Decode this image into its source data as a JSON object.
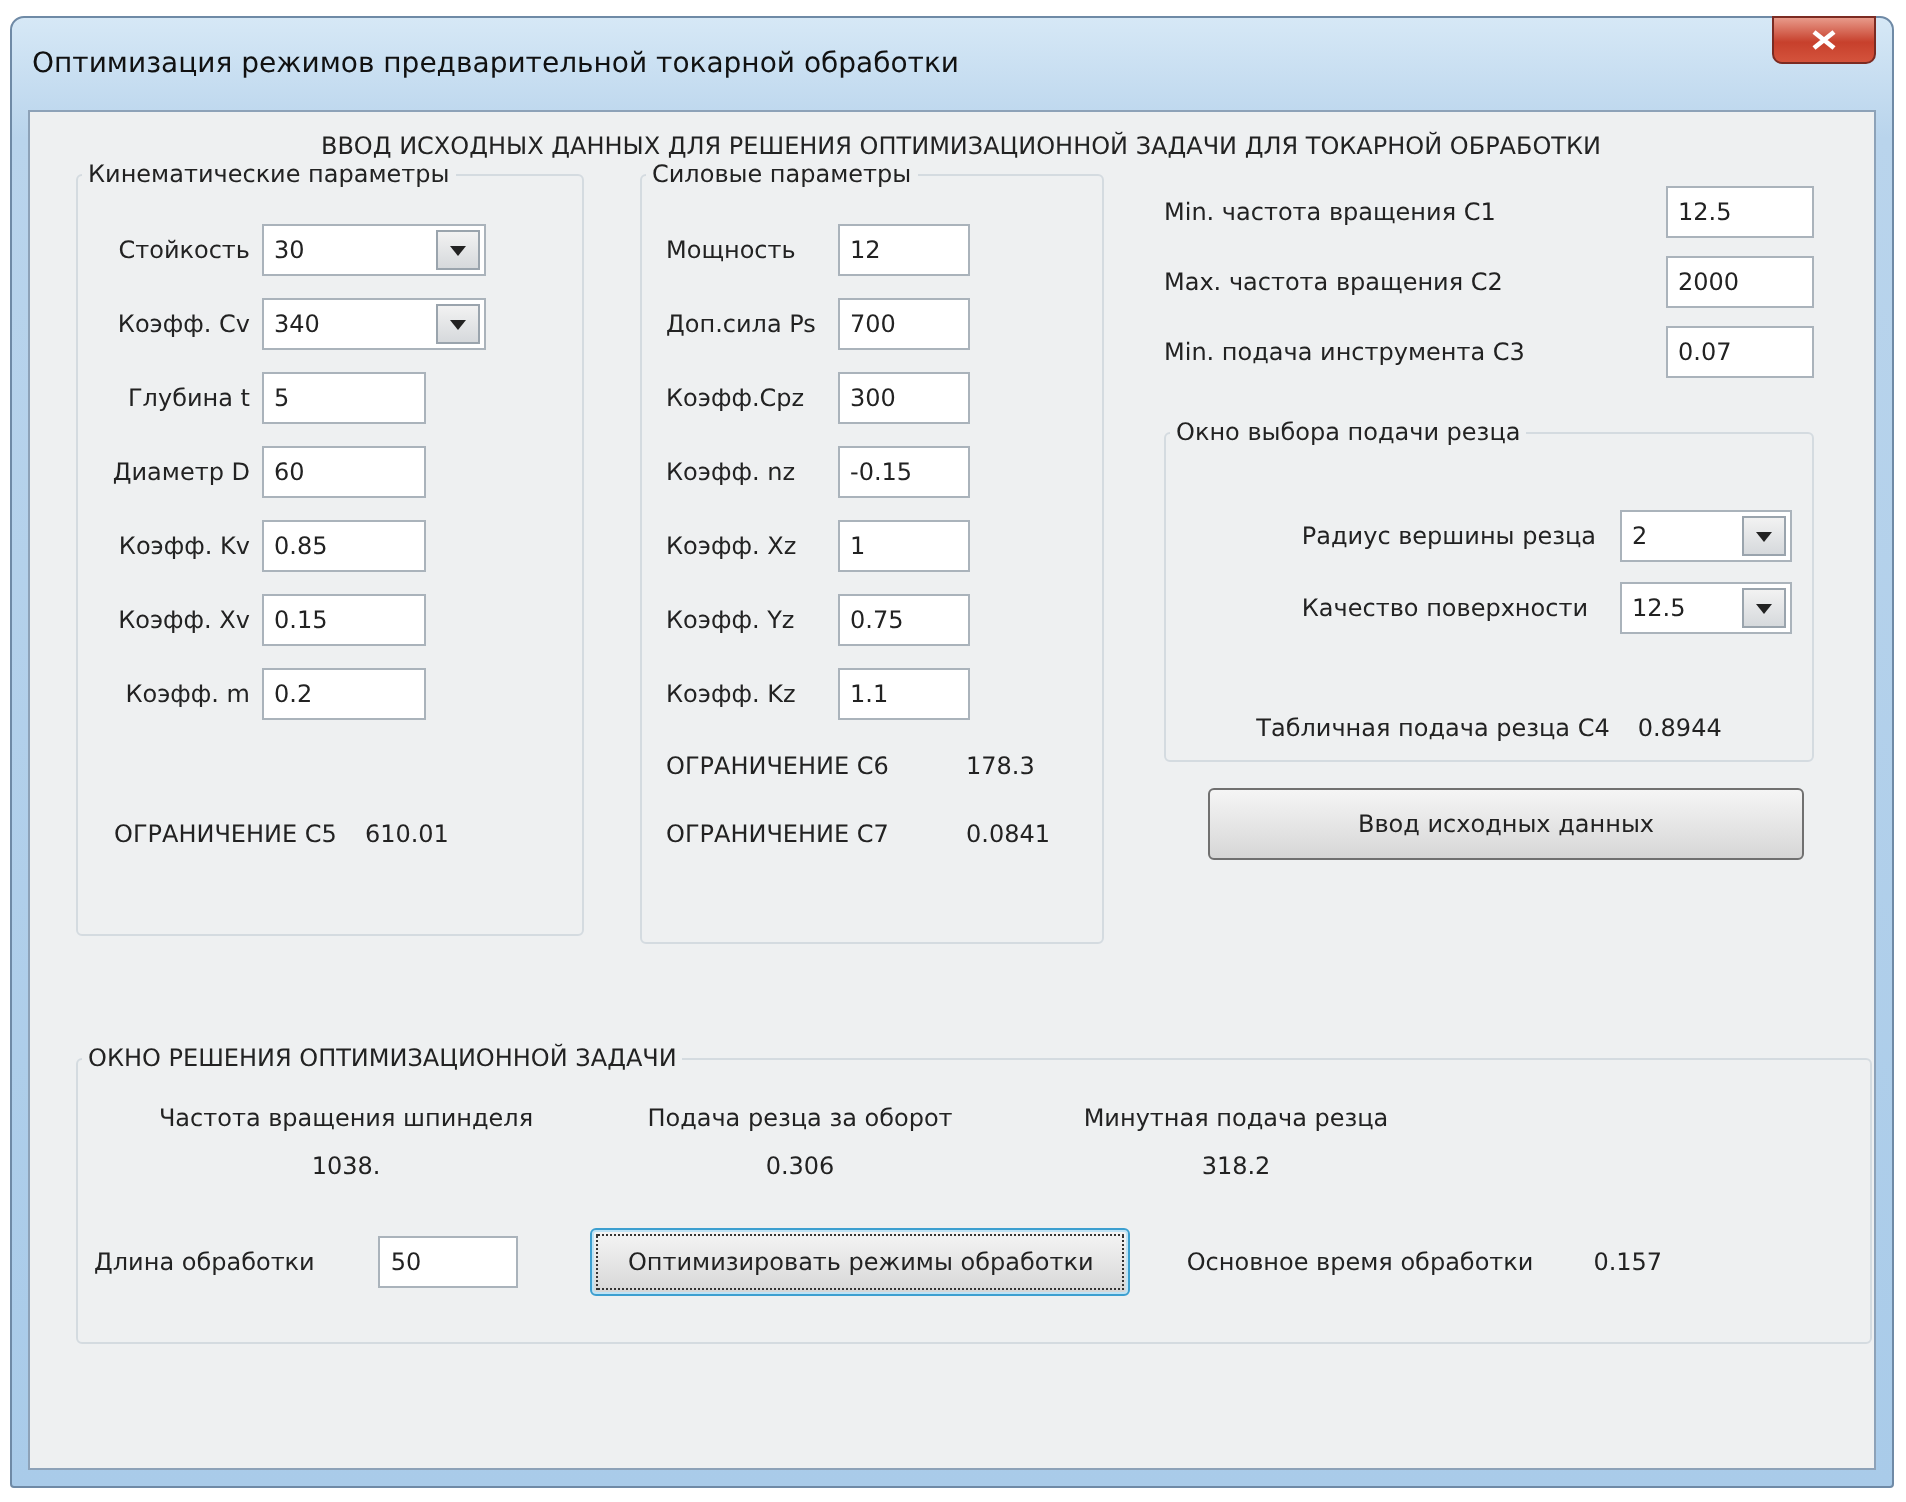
{
  "window": {
    "title": "Оптимизация режимов предварительной токарной обработки"
  },
  "heading": "ВВОД ИСХОДНЫХ ДАННЫХ ДЛЯ РЕШЕНИЯ ОПТИМИЗАЦИОННОЙ ЗАДАЧИ ДЛЯ ТОКАРНОЙ ОБРАБОТКИ",
  "kinematic": {
    "title": "Кинематические параметры",
    "fields": [
      {
        "label": "Стойкость",
        "value": "30",
        "kind": "combo"
      },
      {
        "label": "Коэфф. Cv",
        "value": "340",
        "kind": "combo"
      },
      {
        "label": "Глубина t",
        "value": "5",
        "kind": "text"
      },
      {
        "label": "Диаметр D",
        "value": "60",
        "kind": "text"
      },
      {
        "label": "Коэфф. Kv",
        "value": "0.85",
        "kind": "text"
      },
      {
        "label": "Коэфф. Xv",
        "value": "0.15",
        "kind": "text"
      },
      {
        "label": "Коэфф. m",
        "value": "0.2",
        "kind": "text"
      }
    ],
    "limits": [
      {
        "label": "ОГРАНИЧЕНИЕ  C5",
        "value": "610.01"
      }
    ]
  },
  "force": {
    "title": "Силовые параметры",
    "fields": [
      {
        "label": "Мощность",
        "value": "12",
        "kind": "text"
      },
      {
        "label": "Доп.сила Ps",
        "value": "700",
        "kind": "text"
      },
      {
        "label": "Коэфф.Cpz",
        "value": "300",
        "kind": "text"
      },
      {
        "label": "Коэфф. nz",
        "value": "-0.15",
        "kind": "text"
      },
      {
        "label": "Коэфф. Xz",
        "value": "1",
        "kind": "text"
      },
      {
        "label": "Коэфф. Yz",
        "value": "0.75",
        "kind": "text"
      },
      {
        "label": "Коэфф. Kz",
        "value": "1.1",
        "kind": "text"
      }
    ],
    "limits": [
      {
        "label": "ОГРАНИЧЕНИЕ  C6",
        "value": "178.3"
      },
      {
        "label": "ОГРАНИЧЕНИЕ  C7",
        "value": "0.0841"
      }
    ]
  },
  "constraints": [
    {
      "label": "Min. частота вращения   C1",
      "value": "12.5"
    },
    {
      "label": "Max. частота вращения   C2",
      "value": "2000"
    },
    {
      "label": "Min. подача инструмента C3",
      "value": "0.07"
    }
  ],
  "feed_selection": {
    "title": "Окно выбора подачи резца",
    "fields": [
      {
        "label": "Радиус вершины резца",
        "value": "2",
        "kind": "combo"
      },
      {
        "label": "Качество поверхности",
        "value": "12.5",
        "kind": "combo"
      }
    ],
    "result": {
      "label": "Табличная подача резца  C4",
      "value": "0.8944"
    }
  },
  "input_button": {
    "label": "Ввод исходных данных",
    "focused": false
  },
  "solution": {
    "title": "ОКНО РЕШЕНИЯ ОПТИМИЗАЦИОННОЙ ЗАДАЧИ",
    "results": [
      {
        "label": "Частота вращения шпинделя",
        "value": "1038."
      },
      {
        "label": "Подача резца за оборот",
        "value": "0.306"
      },
      {
        "label": "Минутная подача резца",
        "value": "318.2"
      }
    ],
    "length": {
      "label": "Длина обработки",
      "value": "50"
    },
    "optimize_button": {
      "label": "Оптимизировать режимы обработки",
      "focused": true
    },
    "main_time": {
      "label": "Основное время обработки",
      "value": "0.157"
    }
  }
}
